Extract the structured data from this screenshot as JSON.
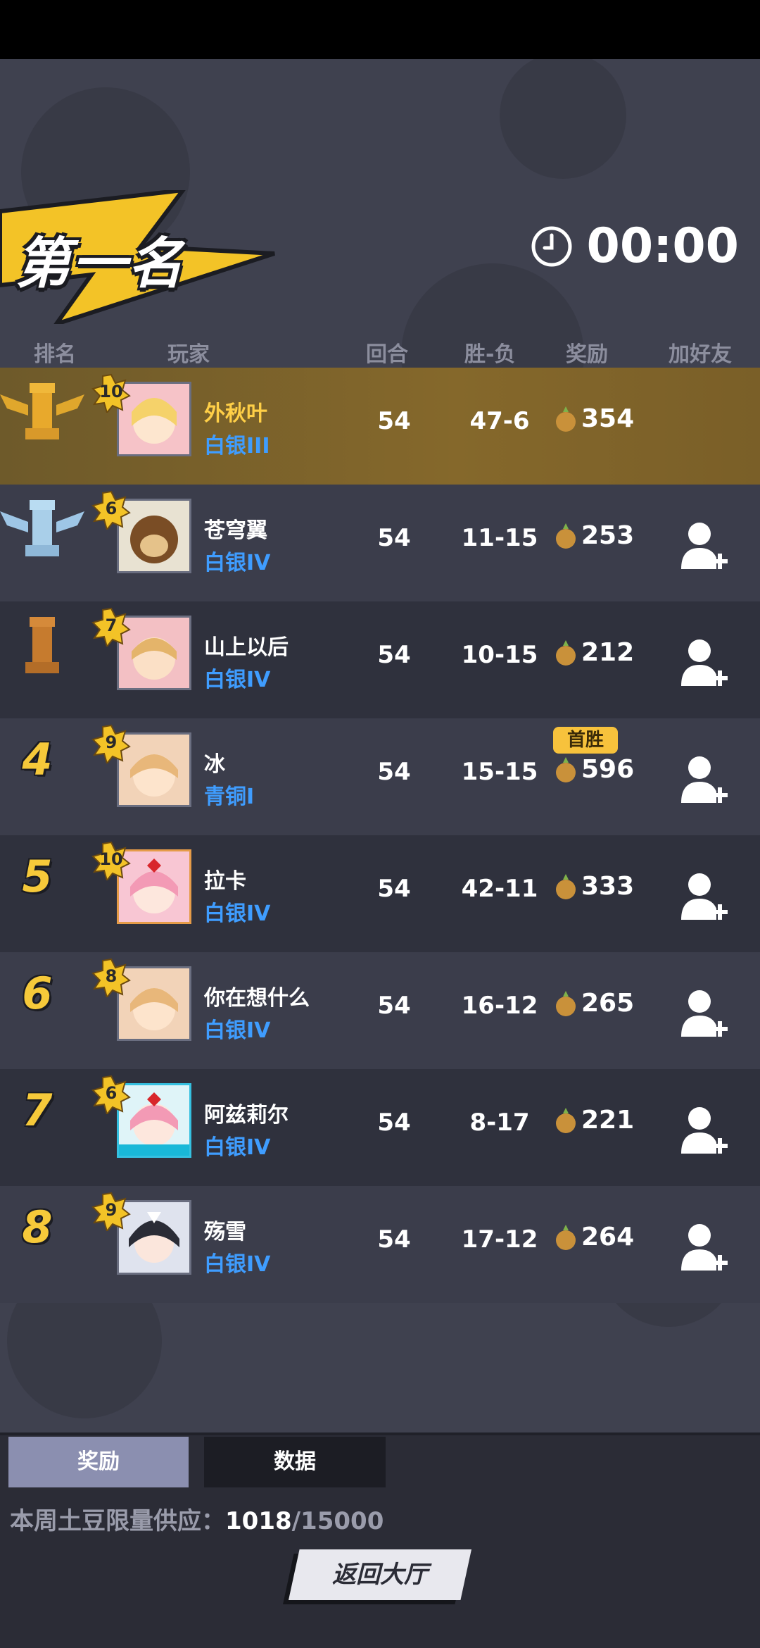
{
  "header": {
    "title": "第一名",
    "timer": "00:00"
  },
  "columns": {
    "rank": "排名",
    "player": "玩家",
    "rounds": "回合",
    "winloss": "胜-负",
    "reward": "奖励",
    "addfriend": "加好友"
  },
  "rows": [
    {
      "rank": "1",
      "level": "10",
      "name": "外秋叶",
      "tier": "白银III",
      "rounds": "54",
      "wl": "47-6",
      "reward": "354",
      "first_win": ""
    },
    {
      "rank": "2",
      "level": "6",
      "name": "苍穹翼",
      "tier": "白银IV",
      "rounds": "54",
      "wl": "11-15",
      "reward": "253",
      "first_win": ""
    },
    {
      "rank": "3",
      "level": "7",
      "name": "山上以后",
      "tier": "白银IV",
      "rounds": "54",
      "wl": "10-15",
      "reward": "212",
      "first_win": ""
    },
    {
      "rank": "4",
      "level": "9",
      "name": "冰",
      "tier": "青铜I",
      "rounds": "54",
      "wl": "15-15",
      "reward": "596",
      "first_win": "首胜"
    },
    {
      "rank": "5",
      "level": "10",
      "name": "拉卡",
      "tier": "白银IV",
      "rounds": "54",
      "wl": "42-11",
      "reward": "333",
      "first_win": ""
    },
    {
      "rank": "6",
      "level": "8",
      "name": "你在想什么",
      "tier": "白银IV",
      "rounds": "54",
      "wl": "16-12",
      "reward": "265",
      "first_win": ""
    },
    {
      "rank": "7",
      "level": "6",
      "name": "阿兹莉尔",
      "tier": "白银IV",
      "rounds": "54",
      "wl": "8-17",
      "reward": "221",
      "first_win": ""
    },
    {
      "rank": "8",
      "level": "9",
      "name": "殇雪",
      "tier": "白银IV",
      "rounds": "54",
      "wl": "17-12",
      "reward": "264",
      "first_win": ""
    }
  ],
  "tabs": {
    "reward": "奖励",
    "data": "数据"
  },
  "supply": {
    "label": "本周土豆限量供应：",
    "current": "1018",
    "max": "/15000"
  },
  "back_button": "返回大厅",
  "colors": {
    "gold": "#f6c93a",
    "tier_blue": "#3f9dff",
    "first_row": "#85682b"
  }
}
